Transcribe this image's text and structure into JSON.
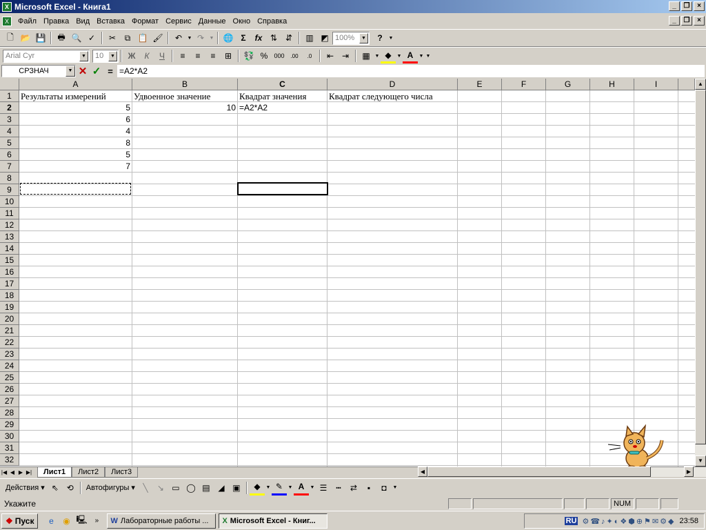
{
  "window": {
    "title": "Microsoft Excel - Книга1",
    "app_icon": "excel-icon"
  },
  "menu": [
    "Файл",
    "Правка",
    "Вид",
    "Вставка",
    "Формат",
    "Сервис",
    "Данные",
    "Окно",
    "Справка"
  ],
  "toolbar": {
    "zoom": "100%",
    "font": "Arial Cyr",
    "size": "10",
    "bold": "Ж",
    "italic": "К",
    "underline": "Ч"
  },
  "formula_bar": {
    "name_box": "СРЗНАЧ",
    "formula": "=A2*A2"
  },
  "columns": [
    "A",
    "B",
    "C",
    "D",
    "E",
    "F",
    "G",
    "H",
    "I"
  ],
  "rows": [
    "1",
    "2",
    "3",
    "4",
    "5",
    "6",
    "7",
    "8",
    "9",
    "10",
    "11",
    "12",
    "13",
    "14",
    "15",
    "16",
    "17",
    "18",
    "19",
    "20",
    "21",
    "22",
    "23",
    "24",
    "25",
    "26",
    "27",
    "28",
    "29",
    "30",
    "31",
    "32"
  ],
  "cells": {
    "A1": "Результаты измерений",
    "B1": "Удвоенное значение",
    "C1": "Квадрат значения",
    "D1": "Квадрат следующего числа",
    "A2": "5",
    "A3": "6",
    "A4": "4",
    "A5": "8",
    "A6": "5",
    "A7": "7",
    "B2": "10",
    "C2": "=A2*A2"
  },
  "sheets": [
    "Лист1",
    "Лист2",
    "Лист3"
  ],
  "drawing": {
    "actions": "Действия",
    "autoshapes": "Автофигуры"
  },
  "status": {
    "mode": "Укажите",
    "num": "NUM"
  },
  "taskbar": {
    "start": "Пуск",
    "task1": "Лабораторные работы ...",
    "task2": "Microsoft Excel - Книг...",
    "lang": "RU",
    "clock": "23:58"
  }
}
